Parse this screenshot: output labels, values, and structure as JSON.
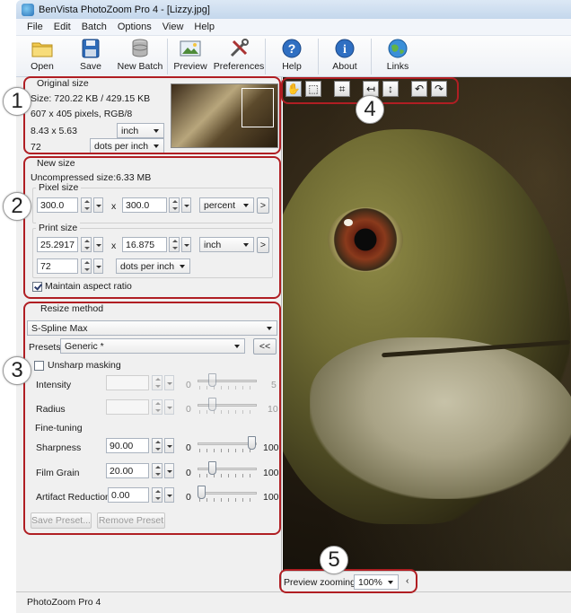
{
  "window": {
    "title": "BenVista PhotoZoom Pro 4 - [Lizzy.jpg]"
  },
  "menu": [
    "File",
    "Edit",
    "Batch",
    "Options",
    "View",
    "Help"
  ],
  "toolbar": {
    "open": "Open",
    "save": "Save",
    "new_batch": "New Batch",
    "preview": "Preview",
    "preferences": "Preferences",
    "help": "Help",
    "about": "About",
    "links": "Links"
  },
  "original": {
    "label": "Original size",
    "size_line": "Size: 720.22 KB / 429.15 KB",
    "pixels_line": "607 x 405 pixels, RGB/8",
    "dims": "8.43 x 5.63",
    "dims_unit": "inch",
    "res": "72",
    "res_unit": "dots per inch"
  },
  "newsize": {
    "label": "New size",
    "uncompressed": "Uncompressed size:6.33 MB",
    "pixel_label": "Pixel size",
    "width": "300.0",
    "height": "300.0",
    "pixel_unit": "percent",
    "x": "x",
    "print_label": "Print size",
    "print_width": "25.2917",
    "print_height": "16.875",
    "print_unit": "inch",
    "print_res": "72",
    "print_res_unit": "dots per inch",
    "maintain": "Maintain aspect ratio",
    "more": ">"
  },
  "resize": {
    "label": "Resize method",
    "method": "S-Spline Max",
    "presets_label": "Presets:",
    "preset": "Generic *",
    "collapse": "<<",
    "unsharp": "Unsharp masking",
    "intensity": "Intensity",
    "radius": "Radius",
    "zero": "0",
    "intensity_max": "5",
    "radius_max": "10",
    "finetuning": "Fine-tuning",
    "sharpness": "Sharpness",
    "sharpness_val": "90.00",
    "sharpness_level": 0.9,
    "filmgrain": "Film Grain",
    "filmgrain_val": "20.00",
    "filmgrain_level": 0.2,
    "artifact": "Artifact Reduction",
    "artifact_val": "0.00",
    "artifact_level": 0,
    "max100": "100",
    "save_preset": "Save Preset...",
    "remove_preset": "Remove Preset"
  },
  "preview": {
    "zoom_label": "Preview zooming:",
    "zoom_value": "100%"
  },
  "markers": [
    "1",
    "2",
    "3",
    "4",
    "5"
  ],
  "status": "PhotoZoom Pro 4",
  "colors": {
    "marker_red": "#b01e23",
    "title_bar": "#c4d7ec"
  }
}
